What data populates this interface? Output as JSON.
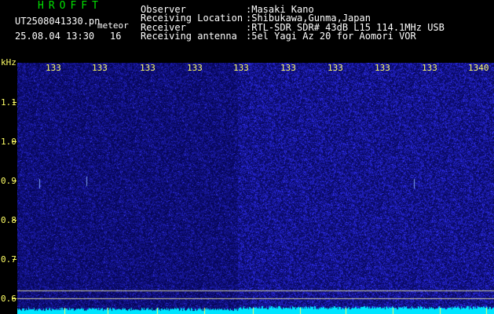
{
  "header": {
    "brand": "HROFFT",
    "filename": "UT2508041330.pn",
    "datetime": "25.08.04 13:30",
    "meteor_label": "meteor",
    "meteor_count": "16",
    "fields": [
      {
        "label": "Observer",
        "value": ":Masaki Kano"
      },
      {
        "label": "Receiving Location",
        "value": ":Shibukawa,Gunma,Japan"
      },
      {
        "label": "Receiver",
        "value": ":RTL-SDR SDR# 43dB L15 114.1MHz USB"
      },
      {
        "label": "Receiving antenna",
        "value": ":5el Yagi Az 20 for Aomori VOR"
      }
    ]
  },
  "axis": {
    "unit": "kHz",
    "y_ticks": [
      "1.1",
      "1.0",
      "0.9",
      "0.8",
      "0.7",
      "0.6"
    ],
    "x_ticks": [
      "133",
      "133",
      "133",
      "133",
      "133",
      "133",
      "133",
      "133",
      "133",
      "1340"
    ]
  },
  "colors": {
    "background": "#000000",
    "plot": "#0a0a55",
    "label": "#ffff66",
    "brand": "#00e000",
    "signal": "#00e5ff"
  }
}
